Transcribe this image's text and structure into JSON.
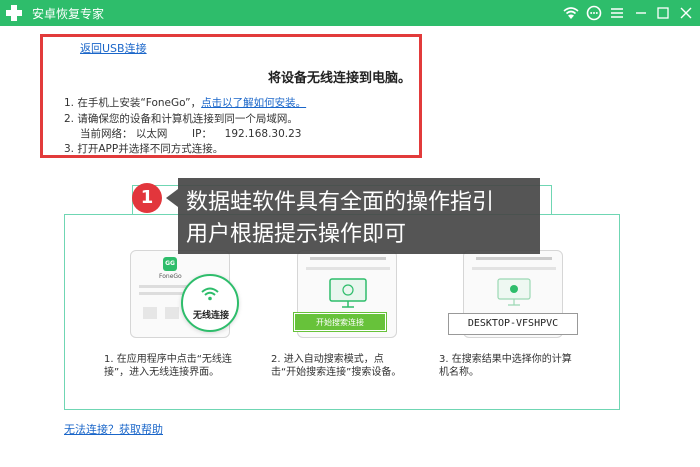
{
  "app": {
    "title": "安卓恢复专家"
  },
  "colors": {
    "brand": "#2ebd6b",
    "link": "#1a66c9",
    "highlight": "#e23b3b",
    "overlay": "#464646",
    "badge": "#e2363c"
  },
  "titlebar_icons": [
    "wifi-icon",
    "chat-icon",
    "menu-icon",
    "minimize-icon",
    "maximize-icon",
    "close-icon"
  ],
  "nav": {
    "back_link": "返回USB连接"
  },
  "instructions": {
    "heading": "将设备无线连接到电脑。",
    "step1_prefix": "1.  在手机上安装“FoneGo”，",
    "step1_link": "点击以了解如何安装。",
    "step2": "2.  请确保您的设备和计算机连接到同一个局域网。",
    "network_label": "当前网络：  以太网",
    "ip_label": "IP：",
    "ip_value": "192.168.30.23",
    "step3": "3.  打开APP并选择不同方式连接。"
  },
  "cards": {
    "phone_app_name": "FoneGo",
    "phone_badge": "GG",
    "wireless_label": "无线连接",
    "start_search_button": "开始搜索连接",
    "device_name": "DESKTOP-VFSHPVC"
  },
  "descriptions": {
    "d1_line1": "1.  在应用程序中点击“无线连",
    "d1_line2": "接”，进入无线连接界面。",
    "d2_line1": "2.  进入自动搜索模式，点",
    "d2_line2": "击“开始搜索连接”搜索设备。",
    "d3_line1": "3.  在搜索结果中选择你的计算",
    "d3_line2": "机名称。"
  },
  "help": {
    "link": "无法连接？获取帮助"
  },
  "annotation": {
    "badge_number": "1",
    "line1": "数据蛙软件具有全面的操作指引",
    "line2": "用户根据提示操作即可"
  }
}
